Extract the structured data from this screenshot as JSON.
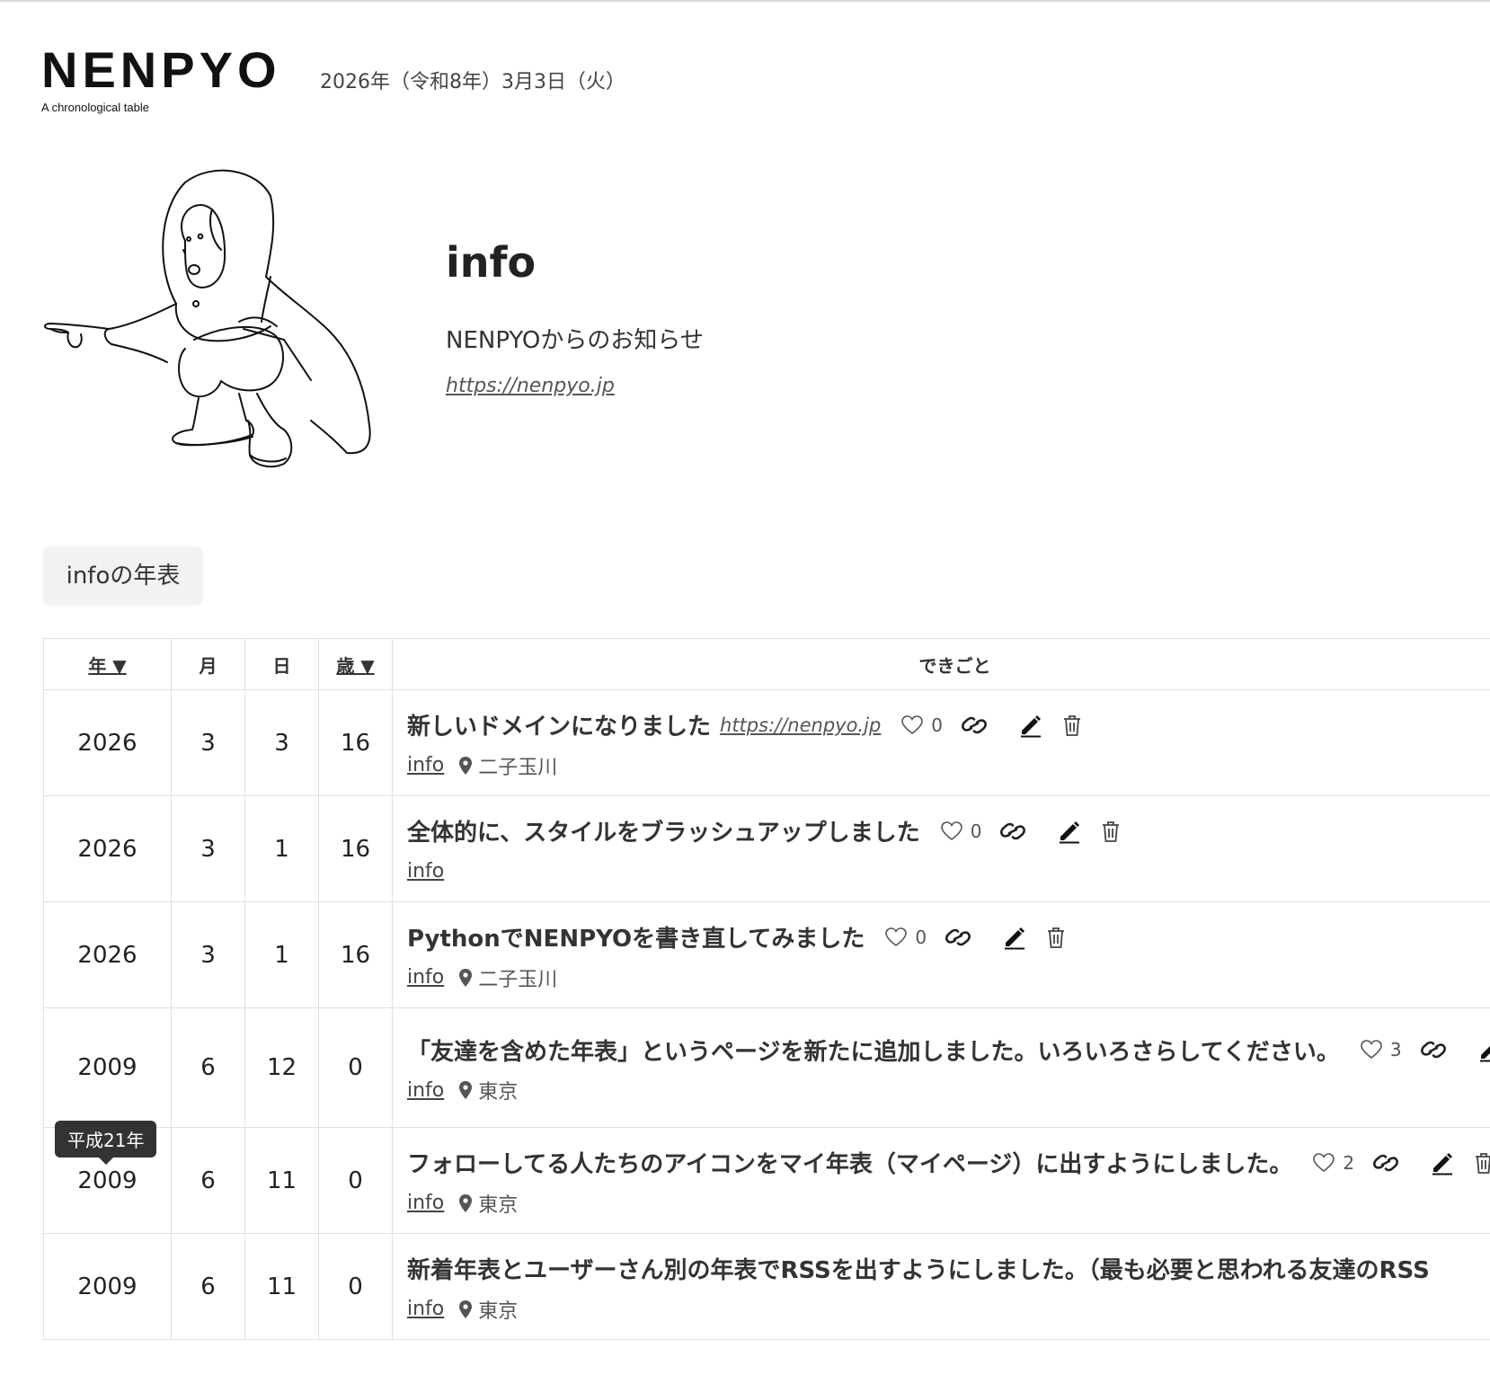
{
  "header": {
    "logo": "NENPYO",
    "logo_subtitle": "A chronological table",
    "date": "2026年（令和8年）3月3日（火）"
  },
  "profile": {
    "name": "info",
    "description": "NENPYOからのお知らせ",
    "url": "https://nenpyo.jp"
  },
  "section_tab": "infoの年表",
  "table": {
    "headers": {
      "year": "年 ▼",
      "month": "月",
      "day": "日",
      "age": "歳 ▼",
      "event": "できごと"
    },
    "rows": [
      {
        "year": "2026",
        "month": "3",
        "day": "3",
        "age": "16",
        "title": "新しいドメインになりました",
        "link": "https://nenpyo.jp",
        "likes": "0",
        "user": "info",
        "place": "二子玉川"
      },
      {
        "year": "2026",
        "month": "3",
        "day": "1",
        "age": "16",
        "title": "全体的に、スタイルをブラッシュアップしました",
        "likes": "0",
        "user": "info"
      },
      {
        "year": "2026",
        "month": "3",
        "day": "1",
        "age": "16",
        "title": "PythonでNENPYOを書き直してみました",
        "likes": "0",
        "user": "info",
        "place": "二子玉川"
      },
      {
        "year": "2009",
        "month": "6",
        "day": "12",
        "age": "0",
        "title": "「友達を含めた年表」というページを新たに追加しました。いろいろさらしてください。",
        "likes": "3",
        "user": "info",
        "place": "東京"
      },
      {
        "year": "2009",
        "month": "6",
        "day": "11",
        "age": "0",
        "title": "フォローしてる人たちのアイコンをマイ年表（マイページ）に出すようにしました。",
        "likes": "2",
        "user": "info",
        "place": "東京",
        "tooltip": "平成21年"
      },
      {
        "year": "2009",
        "month": "6",
        "day": "11",
        "age": "0",
        "title": "新着年表とユーザーさん別の年表でRSSを出すようにしました。（最も必要と思われる友達のRSS",
        "user": "info",
        "place": "東京"
      }
    ]
  }
}
